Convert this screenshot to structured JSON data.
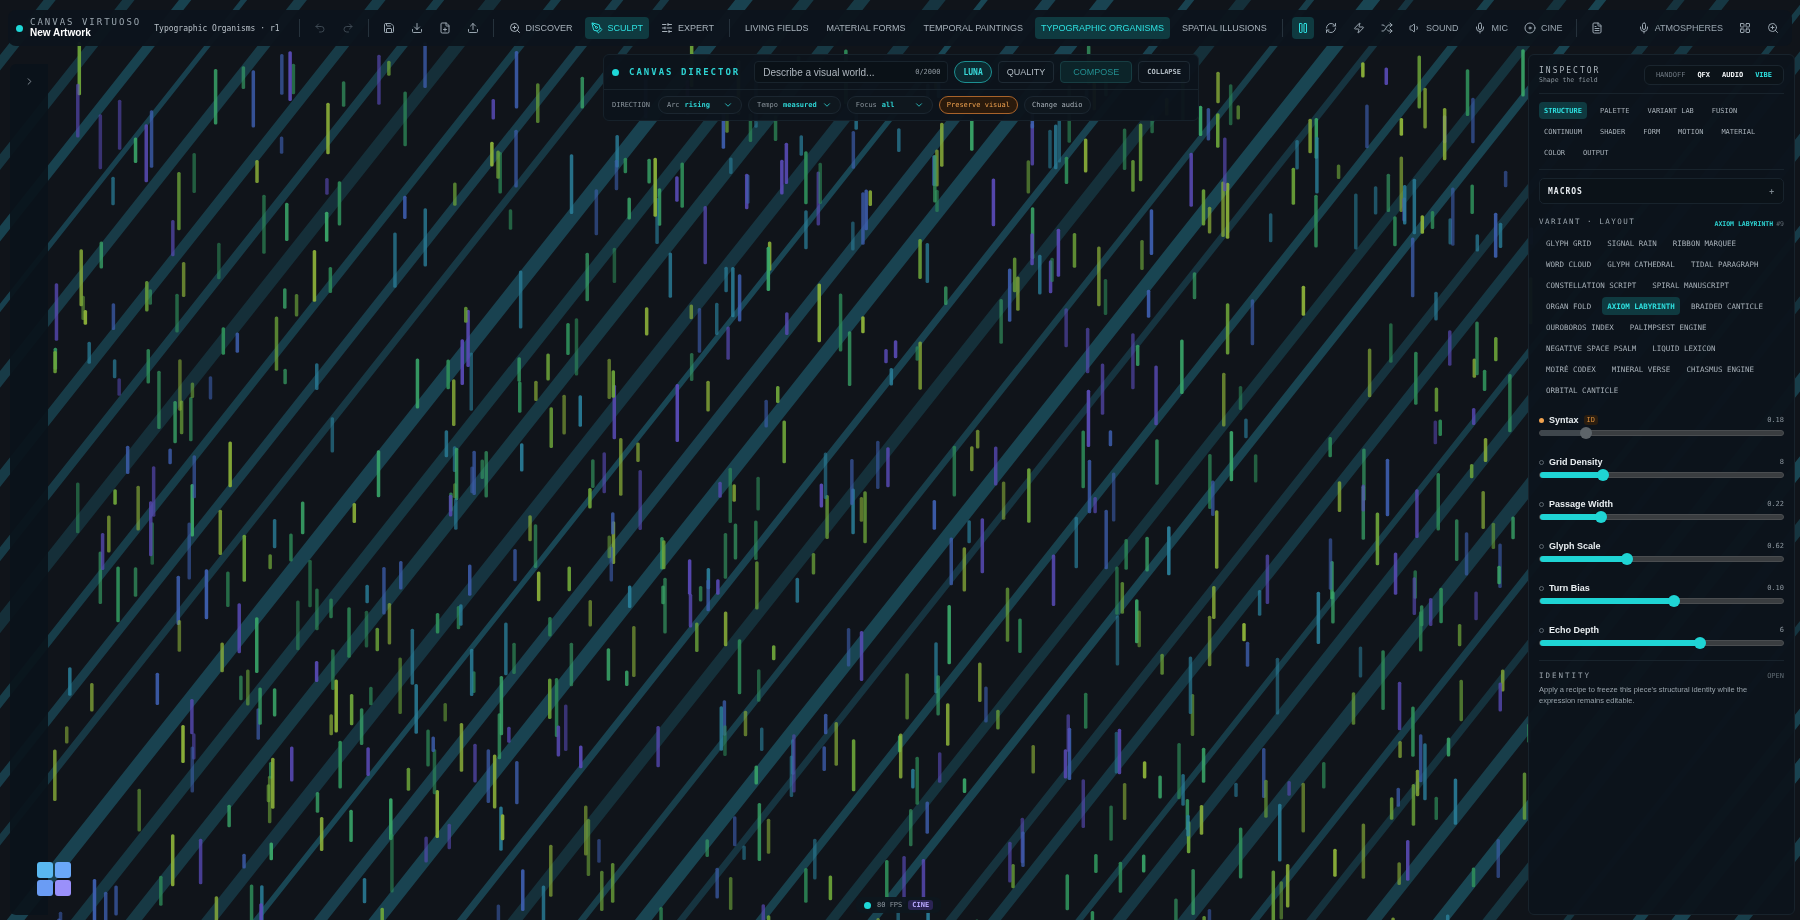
{
  "app": {
    "name": "CANVAS VIRTUOSO",
    "title": "New Artwork",
    "subtitle": "Typographic Organisms · r1"
  },
  "file_buttons": [
    {
      "kind": "undo",
      "disabled": true
    },
    {
      "kind": "redo",
      "disabled": true
    },
    {
      "kind": "save",
      "disabled": false
    },
    {
      "kind": "download",
      "disabled": false
    },
    {
      "kind": "file-plus",
      "disabled": false
    },
    {
      "kind": "upload",
      "disabled": false
    }
  ],
  "modes": [
    {
      "label": "DISCOVER",
      "kind": "search",
      "selected": false
    },
    {
      "label": "SCULPT",
      "kind": "brush",
      "selected": true
    },
    {
      "label": "EXPERT",
      "kind": "sliders",
      "selected": false
    }
  ],
  "galleries": [
    {
      "label": "LIVING FIELDS",
      "selected": false
    },
    {
      "label": "MATERIAL FORMS",
      "selected": false
    },
    {
      "label": "TEMPORAL PAINTINGS",
      "selected": false
    },
    {
      "label": "TYPOGRAPHIC ORGANISMS",
      "selected": true
    },
    {
      "label": "SPATIAL ILLUSIONS",
      "selected": false
    }
  ],
  "transport": [
    {
      "kind": "pause",
      "selected": true
    },
    {
      "kind": "refresh",
      "selected": false
    },
    {
      "kind": "zap",
      "selected": false
    },
    {
      "kind": "shuffle",
      "selected": false
    },
    {
      "kind": "sound",
      "label": "SOUND",
      "selected": false
    },
    {
      "kind": "mic",
      "label": "MIC",
      "selected": false
    },
    {
      "kind": "cine",
      "label": "CINE",
      "selected": false
    }
  ],
  "atmospheres": "ATMOSPHERES",
  "director": {
    "title": "CANVAS DIRECTOR",
    "placeholder": "Describe a visual world...",
    "counter": "0/2000",
    "buttons": [
      {
        "label": "LUNA",
        "kind": "pill"
      },
      {
        "label": "QUALITY",
        "kind": "plain"
      },
      {
        "label": "COMPOSE",
        "kind": "primary",
        "disabled": true
      },
      {
        "label": "COLLAPSE",
        "kind": "small"
      }
    ],
    "direction_label": "DIRECTION",
    "selects": [
      {
        "label": "Arc",
        "value": "rising"
      },
      {
        "label": "Tempo",
        "value": "measured"
      },
      {
        "label": "Focus",
        "value": "all"
      }
    ],
    "chips": [
      {
        "label": "Preserve visual",
        "selected": true
      },
      {
        "label": "Change audio",
        "selected": false
      }
    ]
  },
  "fps": {
    "reading": "80 FPS",
    "badge": "CINE"
  },
  "inspector": {
    "title": "INSPECTOR",
    "subtitle": "Shape the field",
    "modes": [
      {
        "label": "HANDOFF",
        "selected": false,
        "disabled": true
      },
      {
        "label": "QFX",
        "selected": false,
        "disabled": false
      },
      {
        "label": "AUDIO",
        "selected": false,
        "disabled": false
      },
      {
        "label": "VIBE",
        "selected": true,
        "disabled": false
      }
    ],
    "tabs": [
      {
        "label": "STRUCTURE",
        "selected": true
      },
      {
        "label": "PALETTE",
        "selected": false
      },
      {
        "label": "VARIANT LAB",
        "selected": false
      },
      {
        "label": "FUSION",
        "selected": false
      },
      {
        "label": "CONTINUUM",
        "selected": false
      },
      {
        "label": "SHADER",
        "selected": false
      },
      {
        "label": "FORM",
        "selected": false
      },
      {
        "label": "MOTION",
        "selected": false
      },
      {
        "label": "MATERIAL",
        "selected": false
      },
      {
        "label": "COLOR",
        "selected": false
      },
      {
        "label": "OUTPUT",
        "selected": false
      }
    ],
    "macros": {
      "title": "MACROS",
      "toggle": "+"
    },
    "variant": {
      "label": "VARIANT · LAYOUT",
      "current": "AXIOM LABYRINTH",
      "index": "#9",
      "options": [
        {
          "label": "GLYPH GRID",
          "selected": false
        },
        {
          "label": "SIGNAL RAIN",
          "selected": false
        },
        {
          "label": "RIBBON MARQUEE",
          "selected": false
        },
        {
          "label": "WORD CLOUD",
          "selected": false
        },
        {
          "label": "GLYPH CATHEDRAL",
          "selected": false
        },
        {
          "label": "TIDAL PARAGRAPH",
          "selected": false
        },
        {
          "label": "CONSTELLATION SCRIPT",
          "selected": false
        },
        {
          "label": "SPIRAL MANUSCRIPT",
          "selected": false
        },
        {
          "label": "ORGAN FOLD",
          "selected": false
        },
        {
          "label": "AXIOM LABYRINTH",
          "selected": true
        },
        {
          "label": "BRAIDED CANTICLE",
          "selected": false
        },
        {
          "label": "OUROBOROS INDEX",
          "selected": false
        },
        {
          "label": "PALIMPSEST ENGINE",
          "selected": false
        },
        {
          "label": "NEGATIVE SPACE PSALM",
          "selected": false
        },
        {
          "label": "LIQUID LEXICON",
          "selected": false
        },
        {
          "label": "MOIRÉ CODEX",
          "selected": false
        },
        {
          "label": "MINERAL VERSE",
          "selected": false
        },
        {
          "label": "CHIASMUS ENGINE",
          "selected": false
        },
        {
          "label": "ORBITAL CANTICLE",
          "selected": false
        }
      ]
    },
    "params": [
      {
        "name": "Syntax",
        "badge": "ID",
        "value": "0.18",
        "level": 0.19,
        "pinned": true
      },
      {
        "name": "Grid Density",
        "value": "8",
        "level": 0.26,
        "pinned": false
      },
      {
        "name": "Passage Width",
        "value": "0.22",
        "level": 0.25,
        "pinned": false
      },
      {
        "name": "Glyph Scale",
        "value": "0.62",
        "level": 0.36,
        "pinned": false
      },
      {
        "name": "Turn Bias",
        "value": "0.10",
        "level": 0.55,
        "pinned": false
      },
      {
        "name": "Echo Depth",
        "value": "6",
        "level": 0.66,
        "pinned": false
      }
    ],
    "identity": {
      "title": "IDENTITY",
      "action": "OPEN",
      "text": "Apply a recipe to freeze this piece's structural identity while the expression remains editable."
    }
  }
}
